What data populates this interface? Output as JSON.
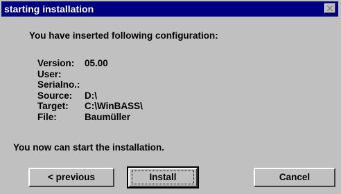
{
  "window": {
    "title": "starting installation"
  },
  "heading": "You have inserted following configuration:",
  "config": [
    {
      "label": "Version:",
      "value": "05.00"
    },
    {
      "label": "User:",
      "value": ""
    },
    {
      "label": "Serialno.:",
      "value": ""
    },
    {
      "label": "Source:",
      "value": "D:\\"
    },
    {
      "label": "Target:",
      "value": "C:\\WinBASS\\"
    },
    {
      "label": "File:",
      "value": "Baumüller"
    }
  ],
  "closing": "You now can start the installation.",
  "buttons": {
    "previous": "< previous",
    "install": "Install",
    "cancel": "Cancel"
  },
  "colors": {
    "titlebar": "#000080",
    "face": "#c0c0c0"
  },
  "icons": {
    "close": "close-icon"
  }
}
